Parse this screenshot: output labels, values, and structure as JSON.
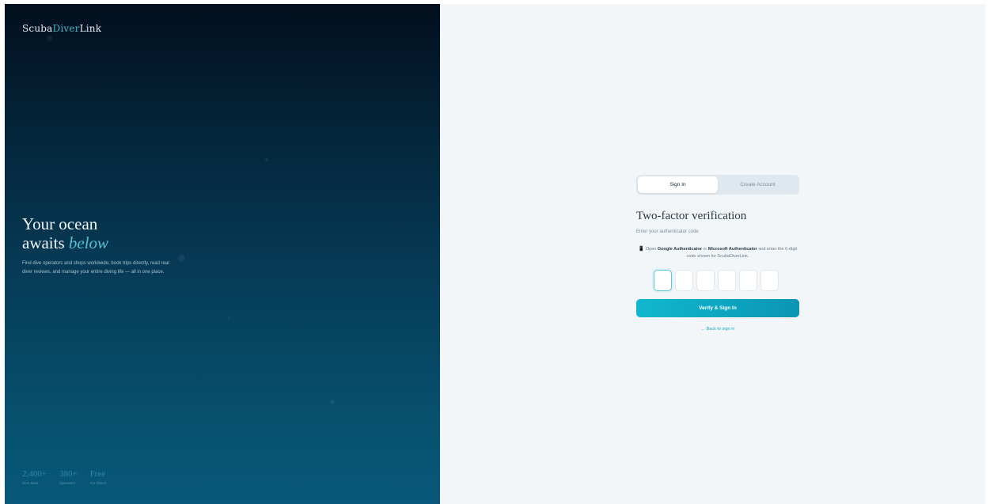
{
  "brand": {
    "part1": "Scuba",
    "part2": "Diver",
    "part3": "Link"
  },
  "hero": {
    "headline_line1": "Your ocean",
    "headline_line2_plain": "awaits",
    "headline_line2_em": "below",
    "lede": "Find dive operators and shops worldwide, book trips directly, read real diver reviews, and manage your entire diving life — all in one place.",
    "stats": [
      {
        "value": "2,400+",
        "label": "Dive Sites"
      },
      {
        "value": "380+",
        "label": "Operators"
      },
      {
        "value": "Free",
        "label": "For Divers"
      }
    ]
  },
  "auth": {
    "tabs": [
      {
        "label": "Sign In",
        "active": true
      },
      {
        "label": "Create Account",
        "active": false
      }
    ],
    "title": "Two-factor verification",
    "subtitle": "Enter your authenticator code",
    "hint": {
      "icon": "phone-icon",
      "prefix": "Open",
      "app1": "Google Authenticator",
      "or": "or",
      "app2": "Microsoft Authenticator",
      "suffix": "and enter the 6-digit code shown for ScubaDiverLink."
    },
    "code_digits": [
      "",
      "",
      "",
      "",
      "",
      ""
    ],
    "verify_label": "Verify & Sign In",
    "back_label": "← Back to sign in"
  },
  "colors": {
    "accent": "#10b8cf",
    "accent_dark": "#0a95b4",
    "hero_top": "#020f1e",
    "hero_bottom": "#07587a",
    "panel_bg": "#f2f6f9"
  }
}
